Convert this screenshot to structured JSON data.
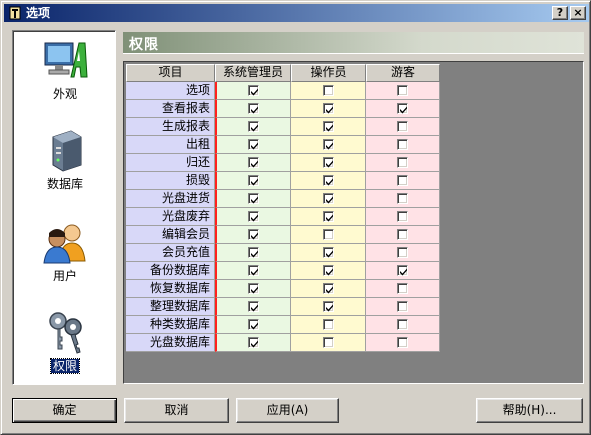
{
  "window": {
    "title": "选项",
    "help_glyph": "?",
    "close_glyph": "×"
  },
  "sidebar": {
    "items": [
      {
        "label": "外观",
        "icon": "appearance-icon"
      },
      {
        "label": "数据库",
        "icon": "database-server-icon"
      },
      {
        "label": "用户",
        "icon": "users-icon"
      },
      {
        "label": "权限",
        "icon": "keys-icon",
        "selected": true
      }
    ]
  },
  "panel": {
    "title": "权限"
  },
  "grid": {
    "columns": [
      "项目",
      "系统管理员",
      "操作员",
      "游客"
    ],
    "rows": [
      {
        "item": "选项",
        "admin": true,
        "operator": false,
        "guest": false
      },
      {
        "item": "查看报表",
        "admin": true,
        "operator": true,
        "guest": true
      },
      {
        "item": "生成报表",
        "admin": true,
        "operator": true,
        "guest": false
      },
      {
        "item": "出租",
        "admin": true,
        "operator": true,
        "guest": false
      },
      {
        "item": "归还",
        "admin": true,
        "operator": true,
        "guest": false
      },
      {
        "item": "损毁",
        "admin": true,
        "operator": true,
        "guest": false
      },
      {
        "item": "光盘进货",
        "admin": true,
        "operator": true,
        "guest": false
      },
      {
        "item": "光盘废弃",
        "admin": true,
        "operator": true,
        "guest": false
      },
      {
        "item": "编辑会员",
        "admin": true,
        "operator": false,
        "guest": false
      },
      {
        "item": "会员充值",
        "admin": true,
        "operator": true,
        "guest": false
      },
      {
        "item": "备份数据库",
        "admin": true,
        "operator": true,
        "guest": true
      },
      {
        "item": "恢复数据库",
        "admin": true,
        "operator": true,
        "guest": false
      },
      {
        "item": "整理数据库",
        "admin": true,
        "operator": true,
        "guest": false
      },
      {
        "item": "种类数据库",
        "admin": true,
        "operator": false,
        "guest": false
      },
      {
        "item": "光盘数据库",
        "admin": true,
        "operator": false,
        "guest": false
      }
    ]
  },
  "buttons": {
    "ok": "确定",
    "cancel": "取消",
    "apply": "应用(A)",
    "help": "帮助(H)..."
  },
  "colors": {
    "titlebar_start": "#0a246a",
    "titlebar_end": "#a6caf0",
    "item_column": "#d8d8f8",
    "admin_column": "#eaf8e2",
    "operator_column": "#fffad0",
    "guest_column": "#ffe2e6",
    "header_band": "#7f9077"
  }
}
